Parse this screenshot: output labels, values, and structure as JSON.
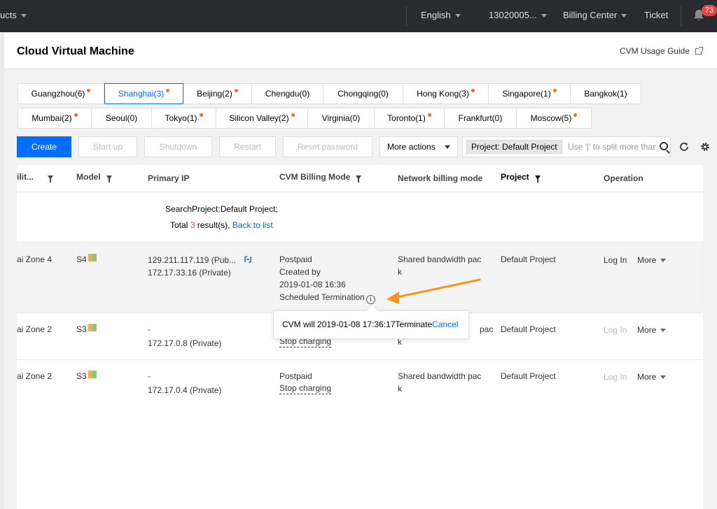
{
  "topnav": {
    "products": "ucts",
    "language": "English",
    "account": "13020005...",
    "billing": "Billing Center",
    "ticket": "Ticket",
    "notifications": "73"
  },
  "header": {
    "title": "Cloud Virtual Machine",
    "guide": "CVM Usage Guide"
  },
  "regions": {
    "row1": [
      {
        "label": "Guangzhou(6)",
        "dot": true
      },
      {
        "label": "Shanghai(3)",
        "dot": true,
        "active": true
      },
      {
        "label": "Beijing(2)",
        "dot": true
      },
      {
        "label": "Chengdu(0)",
        "dot": false
      },
      {
        "label": "Chongqing(0)",
        "dot": false
      },
      {
        "label": "Hong Kong(3)",
        "dot": true
      },
      {
        "label": "Singapore(1)",
        "dot": true
      },
      {
        "label": "Bangkok(1)",
        "dot": false
      }
    ],
    "row2": [
      {
        "label": "Mumbai(2)",
        "dot": true
      },
      {
        "label": "Seoul(0)",
        "dot": false
      },
      {
        "label": "Tokyo(1)",
        "dot": true
      },
      {
        "label": "Silicon Valley(2)",
        "dot": true
      },
      {
        "label": "Virginia(0)",
        "dot": false
      },
      {
        "label": "Toronto(1)",
        "dot": true
      },
      {
        "label": "Frankfurt(0)",
        "dot": false
      },
      {
        "label": "Moscow(5)",
        "dot": true
      }
    ]
  },
  "toolbar": {
    "create": "Create",
    "start_up": "Start up",
    "shutdown": "Shutdown",
    "restart": "Restart",
    "reset_password": "Reset password",
    "more_actions": "More actions",
    "filter_tag": "Project: Default Project",
    "search_placeholder": "Use '|' to split more than one keyword"
  },
  "table": {
    "headers": {
      "zone": "ilit...",
      "model": "Model",
      "primary_ip": "Primary IP",
      "billing_mode": "CVM Billing Mode",
      "network_billing": "Network billing mode",
      "project": "Project",
      "operation": "Operation"
    },
    "search_info": "SearchProject:Default Project;",
    "total_prefix": "Total",
    "total_count": "3",
    "total_suffix": "result(s),",
    "back_link": "Back to list",
    "rows": [
      {
        "zone": "ai Zone 4",
        "model": "S4",
        "ip_public": "129.211.117.119 (Pub...",
        "ip_private": "172.17.33.16 (Private)",
        "billing": "Postpaid",
        "billing_2": "Created by",
        "billing_3": "2019-01-08 16:36",
        "billing_4": "Scheduled Termination",
        "network_1": "Shared bandwidth pac",
        "network_2": "k",
        "project": "Default Project",
        "login": "Log In",
        "more": "More"
      },
      {
        "zone": "ai Zone 2",
        "model": "S3",
        "ip_public": "-",
        "ip_private": "172.17.0.8 (Private)",
        "billing_stop": "Stop charging",
        "network_1": "pac",
        "network_2": "k",
        "project": "Default Project",
        "login": "Log In",
        "more": "More"
      },
      {
        "zone": "ai Zone 2",
        "model": "S3",
        "ip_public": "-",
        "ip_private": "172.17.0.4 (Private)",
        "billing": "Postpaid",
        "billing_stop": "Stop charging",
        "network_1": "Shared bandwidth pac",
        "network_2": "k",
        "project": "Default Project",
        "login": "Log In",
        "more": "More"
      }
    ]
  },
  "tooltip": {
    "text": "CVM will 2019-01-08 17:36:17Terminate",
    "cancel": "Cancel"
  },
  "colors": {
    "accent": "#006eff",
    "annotation_arrow": "#f7941d",
    "dot": "#ff6b1a"
  }
}
